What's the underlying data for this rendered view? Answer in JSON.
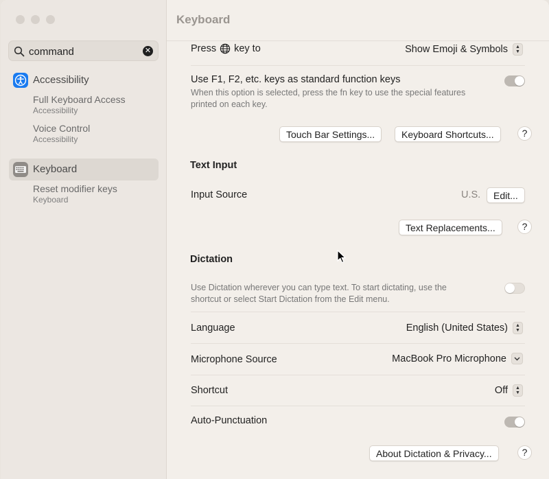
{
  "window": {
    "title": "Keyboard"
  },
  "sidebar": {
    "search": {
      "value": "command",
      "placeholder": "Search"
    },
    "results": [
      {
        "label": "Accessibility",
        "type": "category",
        "icon": "accessibility-icon",
        "color": "#1a7bf0"
      },
      {
        "title": "Full Keyboard Access",
        "subtitle": "Accessibility"
      },
      {
        "title": "Voice Control",
        "subtitle": "Accessibility"
      },
      {
        "label": "Keyboard",
        "type": "category",
        "icon": "keyboard-icon",
        "selected": true
      },
      {
        "title": "Reset modifier keys",
        "subtitle": "Keyboard"
      }
    ]
  },
  "main": {
    "globe_row": {
      "label_prefix": "Press",
      "label_suffix": "key to",
      "value": "Show Emoji & Symbols"
    },
    "fn_row": {
      "label": "Use F1, F2, etc. keys as standard function keys",
      "desc_line1": "When this option is selected, press the fn key to use the special features",
      "desc_line2": "printed on each key.",
      "enabled": true
    },
    "buttons_row1": {
      "touch_bar": "Touch Bar Settings...",
      "shortcuts": "Keyboard Shortcuts...",
      "help": "?"
    },
    "text_input": {
      "heading": "Text Input",
      "input_source_label": "Input Source",
      "input_source_value": "U.S.",
      "edit_button": "Edit...",
      "replacements_button": "Text Replacements...",
      "help": "?"
    },
    "dictation": {
      "heading": "Dictation",
      "desc_line1": "Use Dictation wherever you can type text. To start dictating, use the",
      "desc_line2": "shortcut or select Start Dictation from the Edit menu.",
      "enabled": false,
      "language_label": "Language",
      "language_value": "English (United States)",
      "mic_label": "Microphone Source",
      "mic_value": "MacBook Pro Microphone",
      "shortcut_label": "Shortcut",
      "shortcut_value": "Off",
      "autopunct_label": "Auto-Punctuation",
      "autopunct_enabled": true,
      "about_button": "About Dictation & Privacy...",
      "help": "?"
    }
  }
}
